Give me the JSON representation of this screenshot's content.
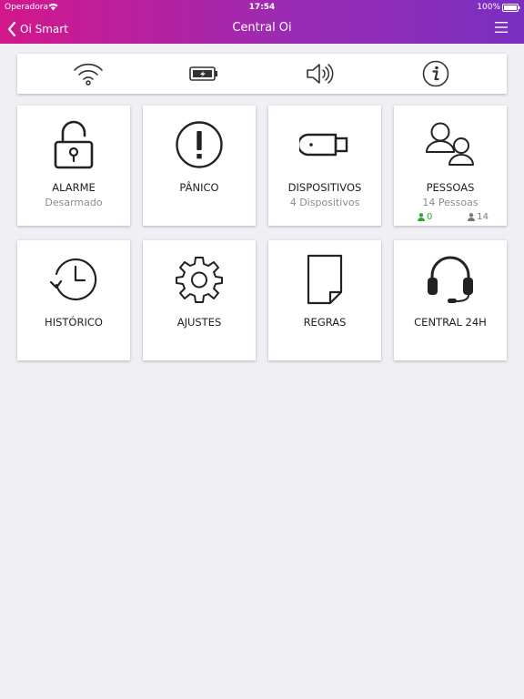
{
  "status_bar": {
    "carrier": "Operadora",
    "time": "17:54",
    "battery": "100%"
  },
  "nav": {
    "back_label": "Oi Smart",
    "title": "Central Oi"
  },
  "status_strip": {
    "icons": [
      "wifi-icon",
      "battery-icon",
      "speaker-icon",
      "info-icon"
    ]
  },
  "tiles": [
    {
      "title": "ALARME",
      "subtitle": "Desarmado",
      "icon": "padlock-open-icon"
    },
    {
      "title": "PÂNICO",
      "icon": "exclamation-circle-icon"
    },
    {
      "title": "DISPOSITIVOS",
      "subtitle": "4 Dispositivos",
      "icon": "usb-device-icon"
    },
    {
      "title": "PESSOAS",
      "subtitle": "14 Pessoas",
      "icon": "people-icon",
      "present": "0",
      "total": "14"
    },
    {
      "title": "HISTÓRICO",
      "icon": "history-clock-icon"
    },
    {
      "title": "AJUSTES",
      "icon": "gear-icon"
    },
    {
      "title": "REGRAS",
      "icon": "document-icon"
    },
    {
      "title": "CENTRAL 24H",
      "icon": "headset-icon"
    }
  ],
  "colors": {
    "accent_start": "#d3178c",
    "accent_end": "#7a2fc1",
    "present_green": "#2ea92e",
    "background": "#efeff4"
  }
}
